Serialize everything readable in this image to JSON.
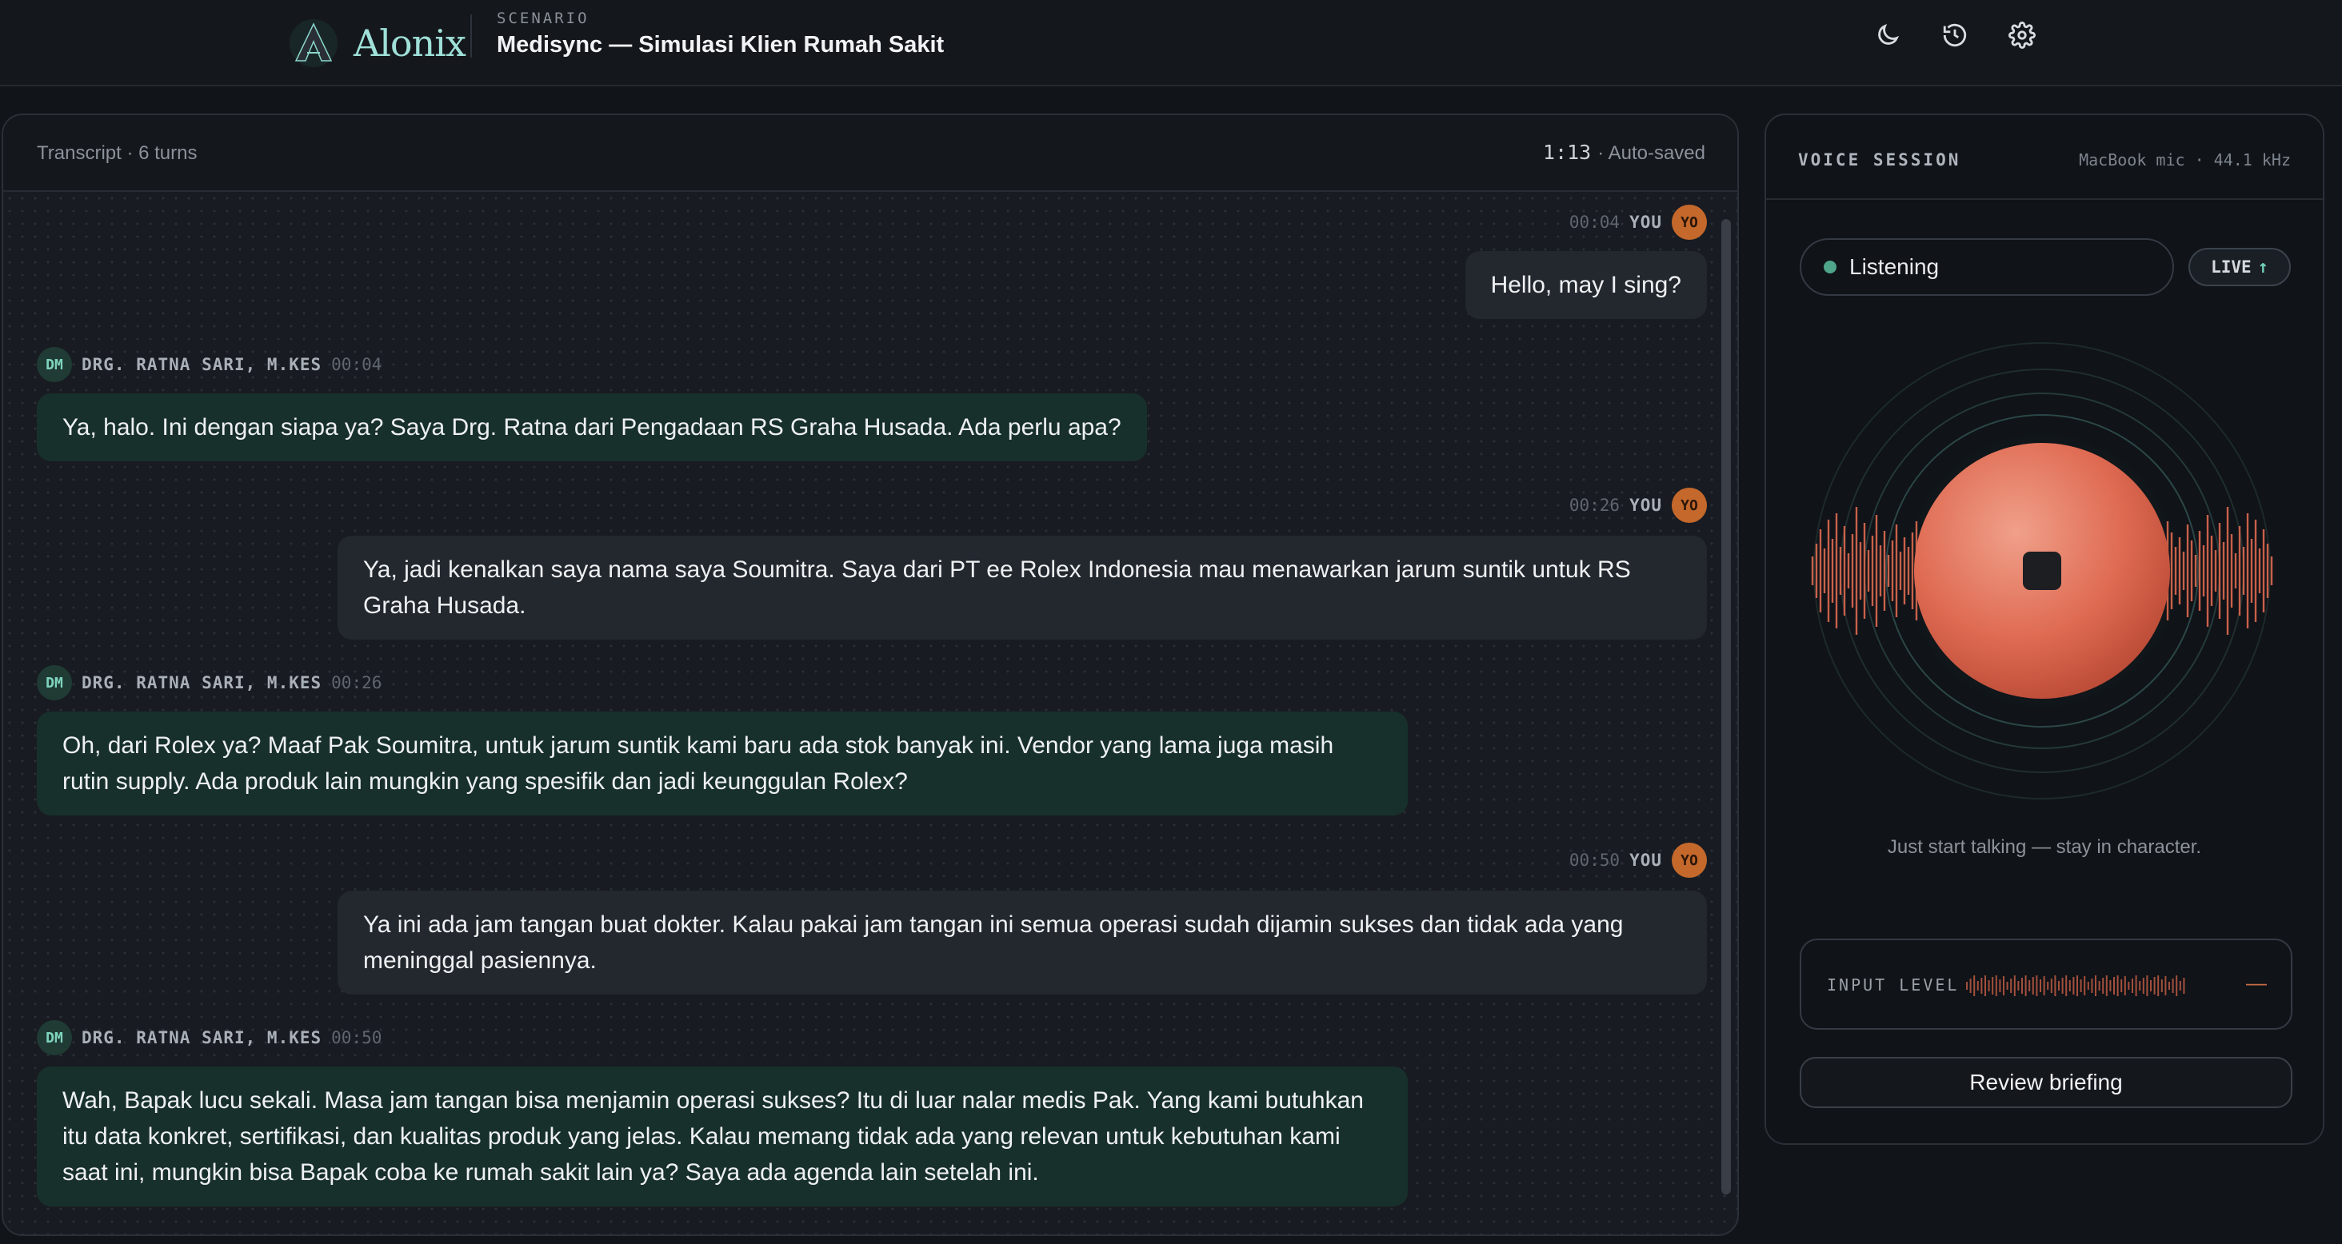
{
  "app": {
    "brand": "Alonix",
    "scenario_label": "SCENARIO",
    "scenario_title": "Medisync — Simulasi Klien Rumah Sakit",
    "icons": [
      "moon-icon",
      "history-icon",
      "gear-icon"
    ]
  },
  "transcript": {
    "header_left": "Transcript · 6 turns",
    "elapsed": "1:13",
    "saved": "· Auto-saved",
    "messages": [
      {
        "speaker": "you",
        "time": "00:04",
        "who": "YOU",
        "initials": "YO",
        "text": "Hello, may I sing?"
      },
      {
        "speaker": "dm",
        "time": "00:04",
        "who": "DRG. RATNA SARI, M.KES",
        "initials": "DM",
        "text": "Ya, halo. Ini dengan siapa ya? Saya Drg. Ratna dari Pengadaan RS Graha Husada. Ada perlu apa?"
      },
      {
        "speaker": "you",
        "time": "00:26",
        "who": "YOU",
        "initials": "YO",
        "text": "Ya, jadi kenalkan saya nama saya Soumitra. Saya dari PT ee Rolex Indonesia mau menawarkan jarum suntik untuk RS Graha Husada."
      },
      {
        "speaker": "dm",
        "time": "00:26",
        "who": "DRG. RATNA SARI, M.KES",
        "initials": "DM",
        "text": "Oh, dari Rolex ya? Maaf Pak Soumitra, untuk jarum suntik kami baru ada stok banyak ini. Vendor yang lama juga masih rutin supply. Ada produk lain mungkin yang spesifik dan jadi keunggulan Rolex?"
      },
      {
        "speaker": "you",
        "time": "00:50",
        "who": "YOU",
        "initials": "YO",
        "text": "Ya ini ada jam tangan buat dokter. Kalau pakai jam tangan ini semua operasi sudah dijamin sukses dan tidak ada yang meninggal pasiennya."
      },
      {
        "speaker": "dm",
        "time": "00:50",
        "who": "DRG. RATNA SARI, M.KES",
        "initials": "DM",
        "text": "Wah, Bapak lucu sekali. Masa jam tangan bisa menjamin operasi sukses? Itu di luar nalar medis Pak. Yang kami butuhkan itu data konkret, sertifikasi, dan kualitas produk yang jelas. Kalau memang tidak ada yang relevan untuk kebutuhan kami saat ini, mungkin bisa Bapak coba ke rumah sakit lain ya? Saya ada agenda lain setelah ini."
      }
    ]
  },
  "voice": {
    "title": "VOICE SESSION",
    "mic": "MacBook mic · 44.1 kHz",
    "status": "Listening",
    "live": "LIVE",
    "hint": "Just start talking — stay in character.",
    "input_level_label": "INPUT LEVEL",
    "input_level_value": "—",
    "review_button": "Review briefing",
    "colors": {
      "accent": "#e0705a",
      "teal": "#4fa58a"
    }
  }
}
